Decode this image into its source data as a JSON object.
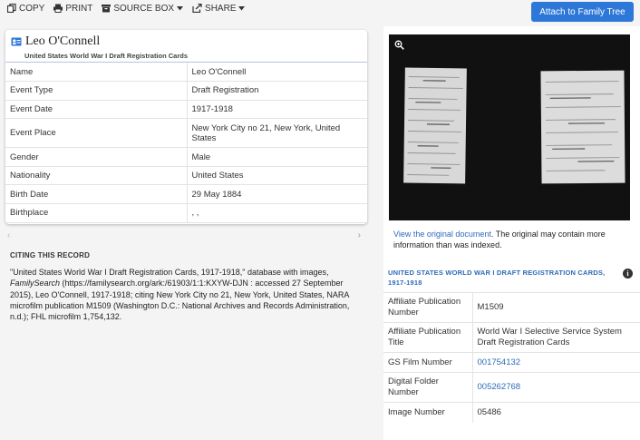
{
  "toolbar": {
    "copy": "COPY",
    "print": "PRINT",
    "source_box": "SOURCE BOX",
    "share": "SHARE",
    "attach": "Attach to Family Tree"
  },
  "record": {
    "name": "Leo O'Connell",
    "collection": "United States World War I Draft Registration Cards",
    "rows": [
      {
        "label": "Name",
        "value": "Leo O'Connell"
      },
      {
        "label": "Event Type",
        "value": "Draft Registration"
      },
      {
        "label": "Event Date",
        "value": "1917-1918"
      },
      {
        "label": "Event Place",
        "value": "New York City no 21, New York, United States"
      },
      {
        "label": "Gender",
        "value": "Male"
      },
      {
        "label": "Nationality",
        "value": "United States"
      },
      {
        "label": "Birth Date",
        "value": "29 May 1884"
      },
      {
        "label": "Birthplace",
        "value": ", ,"
      }
    ]
  },
  "citing": {
    "heading": "CITING THIS RECORD",
    "part1": "\"United States World War I Draft Registration Cards, 1917-1918,\" database with images, ",
    "site": "FamilySearch",
    "part2": " (https://familysearch.org/ark:/61903/1:1:KXYW-DJN : accessed 27 September 2015), Leo O'Connell, 1917-1918; citing New York City no 21, New York, United States, NARA microfilm publication M1509 (Washington D.C.: National Archives and Records Administration, n.d.); FHL microfilm 1,754,132."
  },
  "original": {
    "link": "View the original document",
    "note": ". The original may contain more information than was indexed."
  },
  "collection_info": {
    "heading": "UNITED STATES WORLD WAR I DRAFT REGISTRATION CARDS, 1917-1918",
    "rows": [
      {
        "label": "Affiliate Publication Number",
        "value": "M1509"
      },
      {
        "label": "Affiliate Publication Title",
        "value": "World War I Selective Service System Draft Registration Cards"
      },
      {
        "label": "GS Film Number",
        "value": "001754132"
      },
      {
        "label": "Digital Folder Number",
        "value": "005262768"
      },
      {
        "label": "Image Number",
        "value": "05486"
      }
    ]
  },
  "colors": {
    "accent": "#2d77d8",
    "link": "#2d6bb8"
  }
}
